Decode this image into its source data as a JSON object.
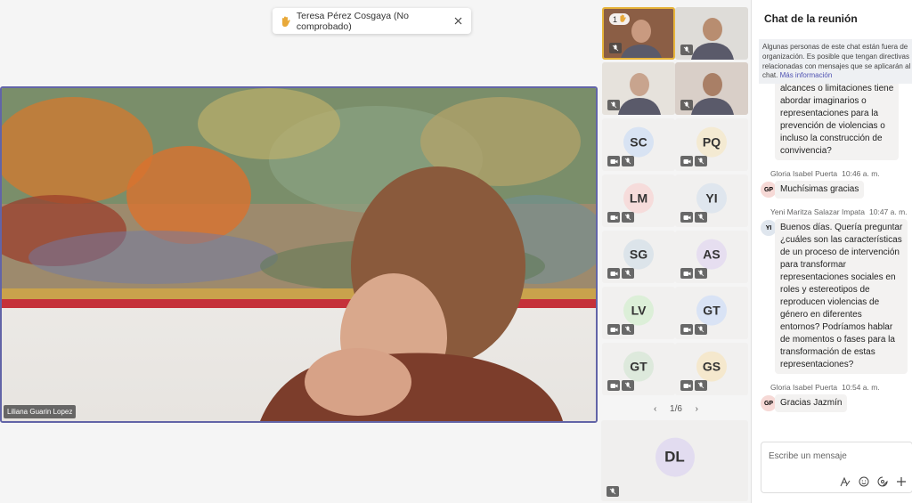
{
  "toast": {
    "text": "Teresa Pérez Cosgaya (No comprobado)"
  },
  "main_video": {
    "name": "Liliana Guarin Lopez"
  },
  "tiles": [
    {
      "type": "video",
      "raised": "1"
    },
    {
      "type": "video"
    },
    {
      "type": "video"
    },
    {
      "type": "video"
    },
    {
      "initials": "SC",
      "color": "#d8e3f3"
    },
    {
      "initials": "PQ",
      "color": "#f4ead2"
    },
    {
      "initials": "LM",
      "color": "#f6dcdb"
    },
    {
      "initials": "YI",
      "color": "#dfe6ee"
    },
    {
      "initials": "SG",
      "color": "#dce4ea"
    },
    {
      "initials": "AS",
      "color": "#e6def0"
    },
    {
      "initials": "LV",
      "color": "#dcefd8"
    },
    {
      "initials": "GT",
      "color": "#d9e3f5"
    },
    {
      "initials": "GT",
      "color": "#dde9dc"
    },
    {
      "initials": "GS",
      "color": "#f5e8cd"
    }
  ],
  "pager": {
    "label": "1/6",
    "prev": "‹",
    "next": "›"
  },
  "big_tile": {
    "initials": "DL",
    "color": "#e2dcf0"
  },
  "chat": {
    "title": "Chat de la reunión",
    "notice": "Algunas personas de este chat están fuera de organización. Es posible que tengan directivas relacionadas con mensajes que se aplicarán al chat.",
    "notice_link": "Más información",
    "messages": [
      {
        "lines": [
          "alcances o limitaciones tiene",
          "abordar imaginarios o",
          "representaciones para la",
          "prevención de violencias o",
          "incluso la construcción de",
          "convivencia?"
        ]
      },
      {
        "author": "Gloria Isabel Puerta",
        "time": "10:46 a. m.",
        "avatar": "GP",
        "avatar_color": "#f6d9d6",
        "lines": [
          "Muchísimas gracias"
        ]
      },
      {
        "author": "Yeni Maritza Salazar Impata",
        "time": "10:47 a. m.",
        "avatar": "YI",
        "avatar_color": "#dfe6ee",
        "lines": [
          "Buenos días. Quería preguntar",
          "¿cuáles son las características",
          "de un proceso de intervención",
          "para transformar",
          "representaciones sociales en",
          "roles y estereotipos de",
          "reproducen violencias de",
          "género en diferentes",
          "entornos? Podríamos hablar",
          "de momentos o fases para la",
          "transformación de estas",
          "representaciones?"
        ]
      },
      {
        "author": "Gloria Isabel Puerta",
        "time": "10:54 a. m.",
        "avatar": "GP",
        "avatar_color": "#f6d9d6",
        "lines": [
          "Gracias Jazmín"
        ]
      }
    ],
    "compose_placeholder": "Escribe un mensaje"
  }
}
